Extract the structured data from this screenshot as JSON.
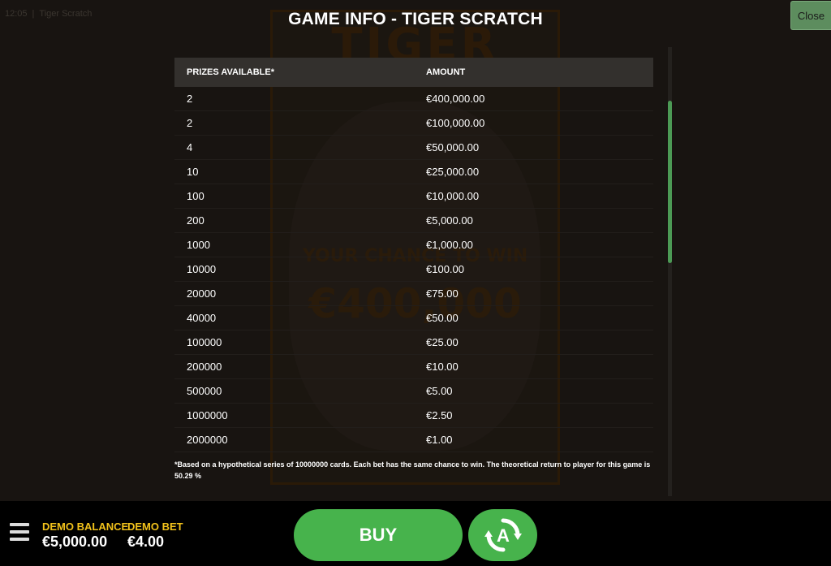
{
  "status_bar": {
    "time": "12:05",
    "separator": "|",
    "game": "Tiger Scratch"
  },
  "modal": {
    "title": "GAME INFO - TIGER SCRATCH",
    "close_label": "Close"
  },
  "prize_table": {
    "headers": {
      "prizes": "PRIZES AVAILABLE*",
      "amount": "AMOUNT"
    },
    "rows": [
      {
        "prizes": "2",
        "amount": "€400,000.00"
      },
      {
        "prizes": "2",
        "amount": "€100,000.00"
      },
      {
        "prizes": "4",
        "amount": "€50,000.00"
      },
      {
        "prizes": "10",
        "amount": "€25,000.00"
      },
      {
        "prizes": "100",
        "amount": "€10,000.00"
      },
      {
        "prizes": "200",
        "amount": "€5,000.00"
      },
      {
        "prizes": "1000",
        "amount": "€1,000.00"
      },
      {
        "prizes": "10000",
        "amount": "€100.00"
      },
      {
        "prizes": "20000",
        "amount": "€75.00"
      },
      {
        "prizes": "40000",
        "amount": "€50.00"
      },
      {
        "prizes": "100000",
        "amount": "€25.00"
      },
      {
        "prizes": "200000",
        "amount": "€10.00"
      },
      {
        "prizes": "500000",
        "amount": "€5.00"
      },
      {
        "prizes": "1000000",
        "amount": "€2.50"
      },
      {
        "prizes": "2000000",
        "amount": "€1.00"
      }
    ],
    "footnote": "*Based on a hypothetical series of 10000000 cards. Each bet has the same chance to win. The theoretical return to player for this game is 50.29 %"
  },
  "background_art": {
    "logo": "TIGER",
    "line1": "YOUR CHANCE TO WIN",
    "line2": "€400,000"
  },
  "bottom_bar": {
    "balance_label": "DEMO BALANCE",
    "balance_value": "€5,000.00",
    "bet_label": "DEMO BET",
    "bet_value": "€4.00",
    "buy_label": "BUY",
    "autoplay_icon": "autoplay-icon"
  },
  "colors": {
    "accent_green": "#47b34c",
    "label_yellow": "#f2c21b",
    "scroll_thumb": "#4c9a55"
  }
}
